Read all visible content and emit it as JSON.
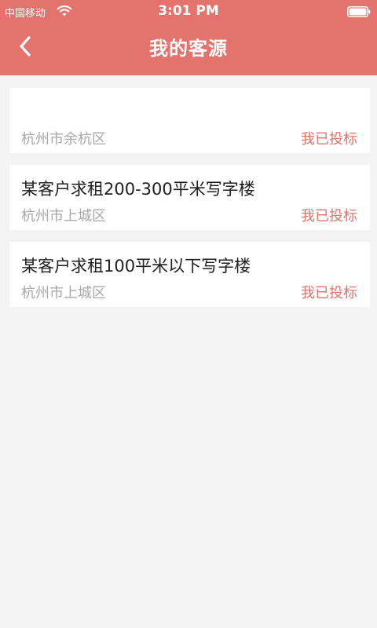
{
  "status_bar": {
    "carrier": "中国移动",
    "time": "3:01 PM"
  },
  "header": {
    "title": "我的客源"
  },
  "colors": {
    "accent": "#e5736d",
    "background": "#f4f3f3",
    "card": "#ffffff",
    "muted_text": "#a8a8a8"
  },
  "icons": {
    "wifi": "wifi-icon",
    "battery": "battery-icon",
    "back": "chevron-left-icon"
  },
  "listings": [
    {
      "title": "",
      "location": "杭州市余杭区",
      "status": "我已投标"
    },
    {
      "title": "某客户求租200-300平米写字楼",
      "location": "杭州市上城区",
      "status": "我已投标"
    },
    {
      "title": "某客户求租100平米以下写字楼",
      "location": "杭州市上城区",
      "status": "我已投标"
    }
  ]
}
